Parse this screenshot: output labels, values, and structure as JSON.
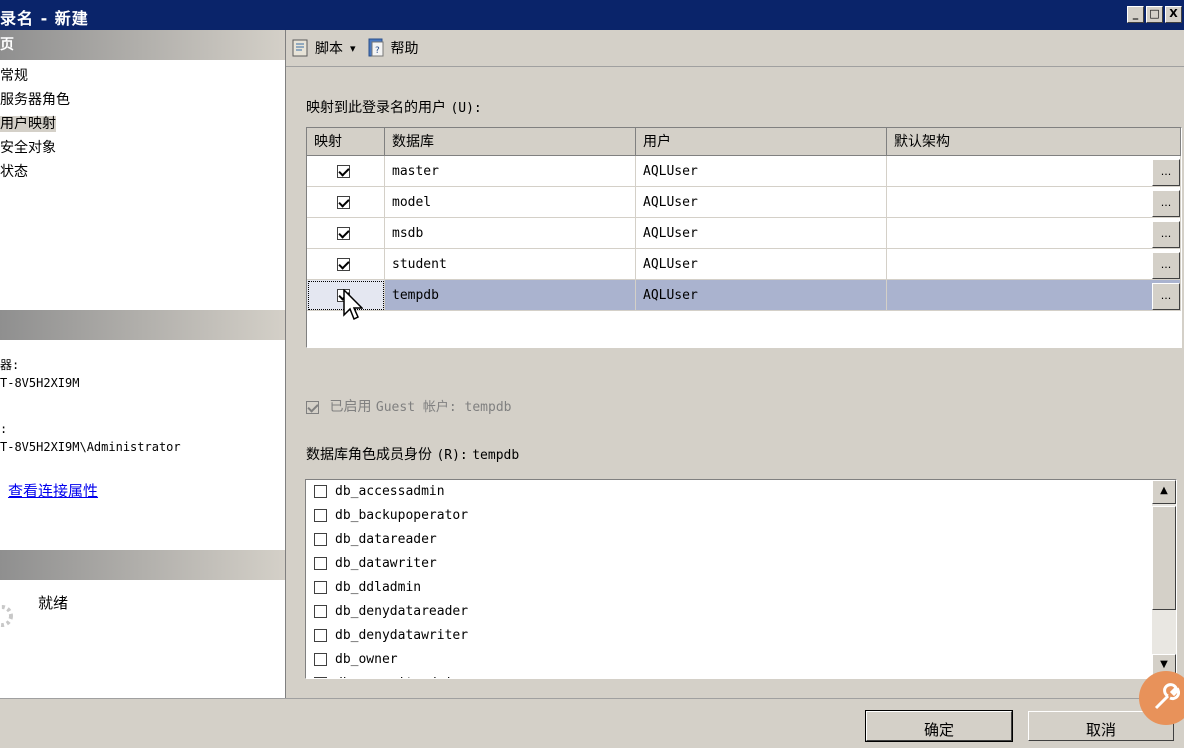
{
  "window": {
    "title": "录名 - 新建",
    "controls": [
      "_",
      "□",
      "X"
    ]
  },
  "left": {
    "select_page_header": "页",
    "nav_items": [
      "常规",
      "服务器角色",
      "用户映射",
      "安全对象",
      "状态"
    ],
    "selected_index": 2,
    "connection": {
      "server_label": "器:",
      "server_value": "T-8V5H2XI9M",
      "connection_label": ":",
      "connection_value": "T-8V5H2XI9M\\Administrator",
      "view_link": "查看连接属性"
    },
    "progress_status": "就绪"
  },
  "toolbar": {
    "script_label": "脚本",
    "script_dropdown": "▾",
    "help_label": "帮助",
    "icons": [
      "script-icon",
      "help-icon"
    ]
  },
  "users_section": {
    "label": "映射到此登录名的用户",
    "accel": "(U):",
    "columns": [
      "映射",
      "数据库",
      "用户",
      "默认架构"
    ],
    "rows": [
      {
        "mapped": true,
        "database": "master",
        "user": "AQLUser",
        "schema": "",
        "button": "..."
      },
      {
        "mapped": true,
        "database": "model",
        "user": "AQLUser",
        "schema": "",
        "button": "..."
      },
      {
        "mapped": true,
        "database": "msdb",
        "user": "AQLUser",
        "schema": "",
        "button": "..."
      },
      {
        "mapped": true,
        "database": "student",
        "user": "AQLUser",
        "schema": "",
        "button": "..."
      },
      {
        "mapped": true,
        "database": "tempdb",
        "user": "AQLUser",
        "schema": "",
        "button": "...",
        "selected": true
      }
    ]
  },
  "guest": {
    "label_cn": "已启用",
    "label_rest": "Guest 帐户: tempdb",
    "checked": true
  },
  "roles_section": {
    "label": "数据库角色成员身份",
    "accel": "(R):",
    "db": "tempdb",
    "roles": [
      "db_accessadmin",
      "db_backupoperator",
      "db_datareader",
      "db_datawriter",
      "db_ddladmin",
      "db_denydatareader",
      "db_denydatawriter",
      "db_owner",
      "db_securityadmin"
    ]
  },
  "buttons": {
    "ok": "确定",
    "cancel": "取消"
  },
  "colors": {
    "titlebar": "#0a246a",
    "selection": "#aab3cf",
    "face": "#d4d0c8"
  }
}
